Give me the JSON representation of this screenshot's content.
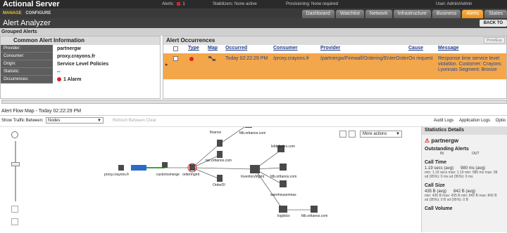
{
  "app": {
    "brand": "Actional Server",
    "alerts_label": "Alerts:",
    "alerts_count": "1",
    "stabilizers": "Stabilizers: None active",
    "provisioning": "Provisioning: None required",
    "user": "User: Admin/Admin",
    "manage": "MANAGE",
    "configure": "CONFIGURE",
    "page_title": "Alert Analyzer",
    "back": "BACK TO"
  },
  "tabs": [
    "Dashboard",
    "Watchlist",
    "Network",
    "Infrastructure",
    "Business",
    "Alerts",
    "States"
  ],
  "grouped_alerts": "Grouped Alerts",
  "info": {
    "title": "Common Alert Information",
    "rows": [
      {
        "label": "Provider:",
        "value": "partnergw"
      },
      {
        "label": "Consumer:",
        "value": "proxy.crayons.fr"
      },
      {
        "label": "Origin:",
        "value": "Service Level Policies"
      },
      {
        "label": "Statistic:",
        "value": "--"
      },
      {
        "label": "Occurrences:",
        "value": "1 Alarm"
      }
    ]
  },
  "occurrences": {
    "title": "Alert Occurrences",
    "close": "Print/Exp",
    "columns": [
      "Type",
      "Map",
      "Occurred",
      "Consumer",
      "Provider",
      "Cause",
      "Message"
    ],
    "row": {
      "occurred": "Today 02:22:29 PM",
      "consumer": "/proxy.crayons.fr",
      "provider": "/partnergw/Firewall/Ordering/EnterOrder",
      "cause": "On request",
      "message": "Response time service level violation. Customer: Crayons Lyonnais Segment: Bronze"
    }
  },
  "flow": {
    "title": "Alert Flow Map - Today 02:22:29 PM",
    "show_label": "Show Traffic Between:",
    "show_value": "Nodes",
    "refresh": "Refresh Between Clear",
    "more_actions": "More actions",
    "audit": "Audit Logs",
    "application": "Application Logs",
    "options": "Optio"
  },
  "stats": {
    "title": "Statistics Details",
    "node": "partnergw",
    "outstanding": "Outstanding Alerts",
    "in": "IN",
    "out": "OUT",
    "call_time": "Call Time",
    "call_time_avg": "1.19 secs (avg)",
    "call_time_avg2": "980 ms (avg)",
    "call_time_minmax": "min: 1.19 secs max: 1.19",
    "call_time_minmax2": "min: 980 ms max: 98",
    "call_time_sd": "sd (95%): 0 ms",
    "call_time_sd2": "sd (95%): 0 ms",
    "call_size": "Call Size",
    "call_size_avg": "435 B (avg)",
    "call_size_avg2": "842 B (avg)",
    "call_size_minmax": "min: 435 B max: 435 B",
    "call_size_minmax2": "min: 842 B max: 842 B",
    "call_size_sd": "sd (95%): 0 B",
    "call_size_sd2": "sd (95%): 0 B",
    "call_volume": "Call Volume"
  },
  "map": {
    "nodes": [
      "finance",
      "fdb.orttanos.com",
      "lebb.fedex.com",
      "tax.orttanos.com",
      "proxy.crayons.fr",
      "partnergw",
      "customsmerge",
      "ordermgmt",
      "OrderDI",
      "InventoryMgmt",
      "fdb.orttanos.com",
      "warehousemnas",
      "logisticx",
      "fdb.orttanos.com"
    ]
  }
}
